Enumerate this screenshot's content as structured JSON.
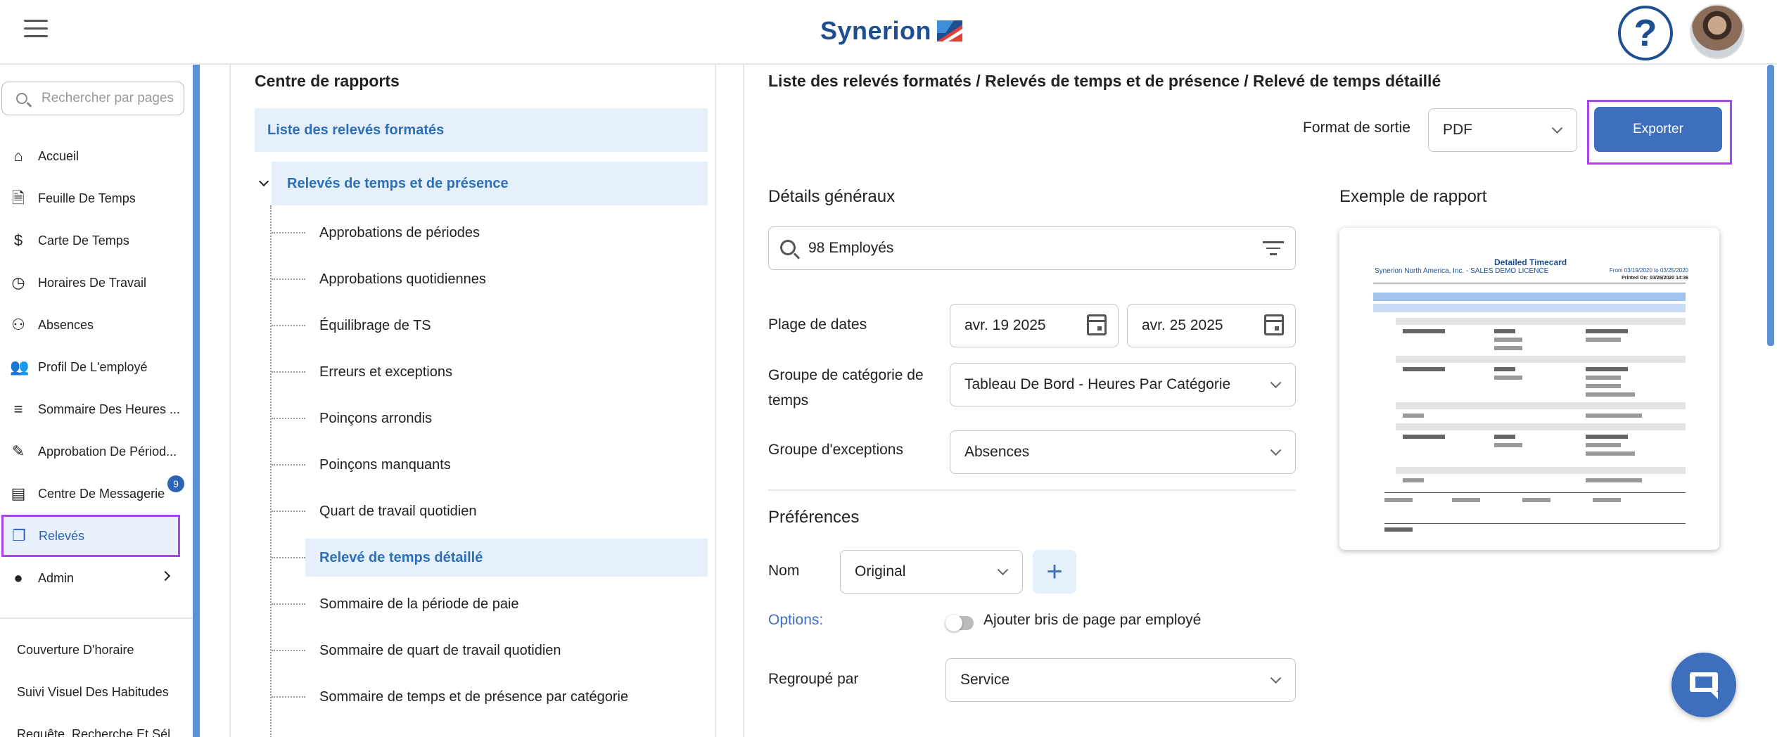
{
  "header": {
    "logo_text": "Synerion",
    "help_label": "?"
  },
  "sidebar": {
    "search_placeholder": "Rechercher par pages",
    "items": [
      {
        "label": "Accueil",
        "icon": "home-icon"
      },
      {
        "label": "Feuille De Temps",
        "icon": "document-icon"
      },
      {
        "label": "Carte De Temps",
        "icon": "dollar-icon"
      },
      {
        "label": "Horaires De Travail",
        "icon": "clock-icon"
      },
      {
        "label": "Absences",
        "icon": "person-off-icon"
      },
      {
        "label": "Profil De L'employé",
        "icon": "people-icon"
      },
      {
        "label": "Sommaire Des Heures ...",
        "icon": "list-icon"
      },
      {
        "label": "Approbation De Périod...",
        "icon": "edit-icon"
      },
      {
        "label": "Centre De Messagerie",
        "icon": "chat-icon",
        "badge": "9"
      },
      {
        "label": "Relevés",
        "icon": "file-copy-icon"
      },
      {
        "label": "Admin",
        "icon": "person-icon"
      }
    ],
    "sub_items": [
      "Couverture D'horaire",
      "Suivi Visuel Des Habitudes",
      "Requête, Recherche Et Sél..."
    ]
  },
  "reports": {
    "title": "Centre de rapports",
    "top_item": "Liste des relevés formatés",
    "group": "Relevés de temps et de présence",
    "children": [
      "Approbations de périodes",
      "Approbations quotidiennes",
      "Équilibrage de TS",
      "Erreurs et exceptions",
      "Poinçons arrondis",
      "Poinçons manquants",
      "Quart de travail quotidien",
      "Relevé de temps détaillé",
      "Sommaire de la période de paie",
      "Sommaire de quart de travail quotidien",
      "Sommaire de temps et de présence par catégorie"
    ],
    "selected_index": 7
  },
  "detail": {
    "breadcrumb": "Liste des relevés formatés / Relevés de temps et de présence / Relevé de temps détaillé",
    "output_format_label": "Format de sortie",
    "output_format_value": "PDF",
    "export_label": "Exporter",
    "general_title": "Détails généraux",
    "employees_value": "98 Employés",
    "date_range_label": "Plage de dates",
    "date_from": "avr. 19 2025",
    "date_to": "avr. 25 2025",
    "category_group_label": "Groupe de catégorie de temps",
    "category_group_value": "Tableau De Bord - Heures Par Catégorie",
    "exceptions_group_label": "Groupe d'exceptions",
    "exceptions_group_value": "Absences",
    "preferences_title": "Préférences",
    "name_label": "Nom",
    "name_value": "Original",
    "options_label": "Options:",
    "page_break_label": "Ajouter bris de page par employé",
    "grouped_by_label": "Regroupé par",
    "grouped_by_value": "Service",
    "example_title": "Exemple de rapport",
    "preview": {
      "title": "Detailed Timecard",
      "subtitle": "Synerion North America, Inc. - SALES DEMO LICENCE",
      "range": "From 03/19/2020 to 03/25/2020",
      "printed": "Printed On: 03/26/2020 14:36"
    }
  },
  "colors": {
    "brand": "#1d4f91",
    "accent": "#3e6fbd",
    "highlight_outline": "#a944e8",
    "selected_bg": "#e6f0fb"
  }
}
